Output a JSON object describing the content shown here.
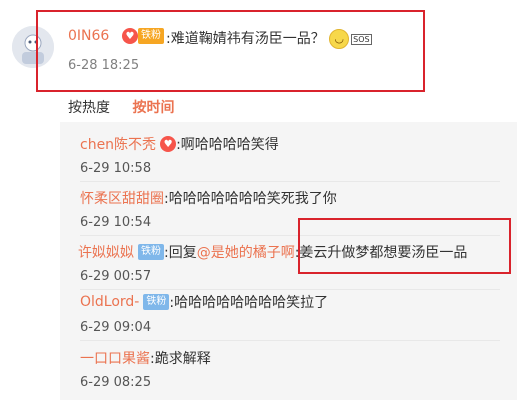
{
  "top_comment": {
    "username": "0IN66",
    "fan_badge": "铁粉",
    "text": ":难道鞠婧祎有汤臣一品？",
    "sos_label": "SOS",
    "time": "6-28 18:25"
  },
  "sort": {
    "hot": "按热度",
    "time": "按时间"
  },
  "replies": [
    {
      "user": "chen陈不秃",
      "badge": "",
      "text": ":啊哈哈哈哈笑得",
      "time": "6-29 10:58"
    },
    {
      "user": "怀柔区甜甜圈",
      "badge": "",
      "text": ":哈哈哈哈哈哈哈笑死我了你",
      "time": "6-29 10:54"
    },
    {
      "user": "许姒姒姒",
      "badge": "铁粉",
      "text_prefix": ":回复",
      "mention": "@是她的橘子啊",
      "text": ":姜云升做梦都想要汤臣一品",
      "time": "6-29 00:57"
    },
    {
      "user": "OldLord-",
      "badge": "铁粉",
      "text": ":哈哈哈哈哈哈哈哈笑拉了",
      "time": "6-29 09:04"
    },
    {
      "user": "一口口果酱",
      "badge": "",
      "text": ":跪求解释",
      "time": "6-29 08:25"
    }
  ],
  "colors": {
    "accent": "#eb7350",
    "highlight_box": "#d9232c",
    "fan_badge_orange": "#f6a623",
    "fan_badge_blue": "#7fb7ea"
  }
}
